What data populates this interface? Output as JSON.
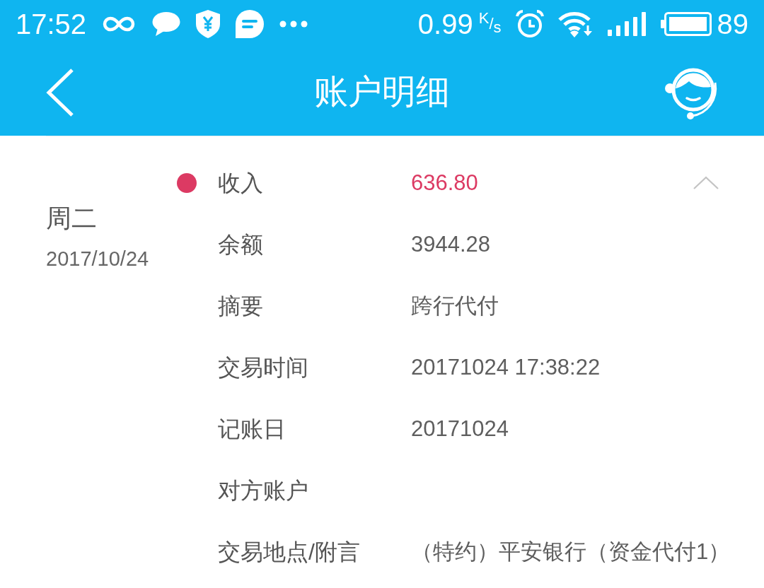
{
  "status_bar": {
    "time": "17:52",
    "speed": "0.99",
    "speed_unit": "$^{K}$/$_{s}$",
    "battery": "89"
  },
  "header": {
    "title": "账户明细"
  },
  "transactions": [
    {
      "weekday": "周二",
      "date": "2017/10/24",
      "expanded": true,
      "color": "#dc3a63",
      "fields": [
        {
          "label": "收入",
          "value": "636.80",
          "kind": "amount"
        },
        {
          "label": "余额",
          "value": "3944.28",
          "kind": "text"
        },
        {
          "label": "摘要",
          "value": "跨行代付",
          "kind": "text"
        },
        {
          "label": "交易时间",
          "value": "20171024 17:38:22",
          "kind": "text"
        },
        {
          "label": "记账日",
          "value": "20171024",
          "kind": "text"
        },
        {
          "label": "对方账户",
          "kind": "text"
        },
        {
          "label": "交易地点/附言",
          "value": "（特约）平安银行（资金代付1）",
          "kind": "text"
        }
      ]
    }
  ]
}
